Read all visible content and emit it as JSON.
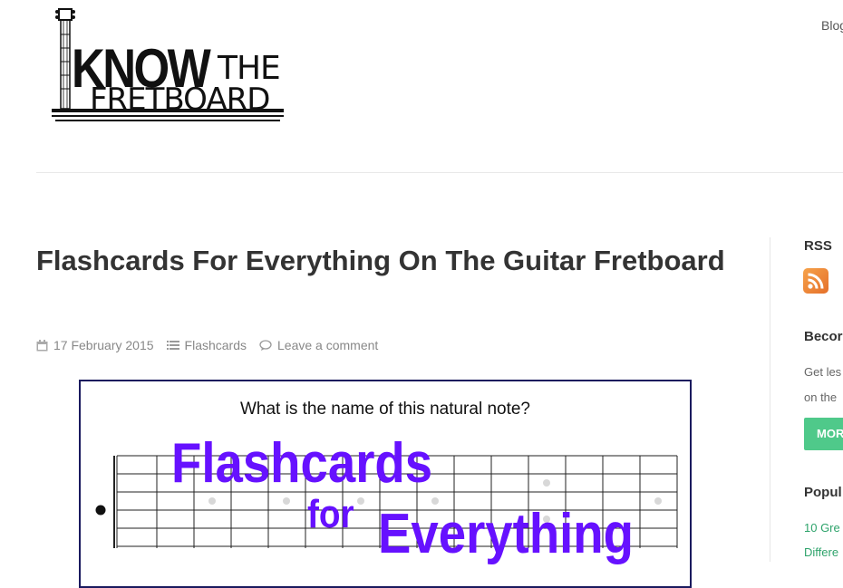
{
  "header": {
    "logo": {
      "line1": "KNOW",
      "line2": "THE",
      "line3": "FRETBOARD"
    },
    "nav": {
      "blog": "Blog"
    }
  },
  "post": {
    "title": "Flashcards For Everything On The Guitar Fretboard",
    "date": "17 February 2015",
    "category": "Flashcards",
    "comment": "Leave a comment",
    "image": {
      "question": "What is the name of this natural note?",
      "overlay_line1": "Flashcards",
      "overlay_line2": "for",
      "overlay_line3": "Everything"
    }
  },
  "sidebar": {
    "rss_title": "RSS",
    "become_title": "Becor",
    "become_line1": "Get les",
    "become_line2": "on the",
    "more_button": "MOR",
    "popular_title": "Popul",
    "popular_link1": "10 Gre",
    "popular_link2": "Differe"
  },
  "colors": {
    "overlay_text": "#6611ff",
    "link": "#2ea36b",
    "button": "#4fc98a",
    "rss": "#e5702a"
  }
}
